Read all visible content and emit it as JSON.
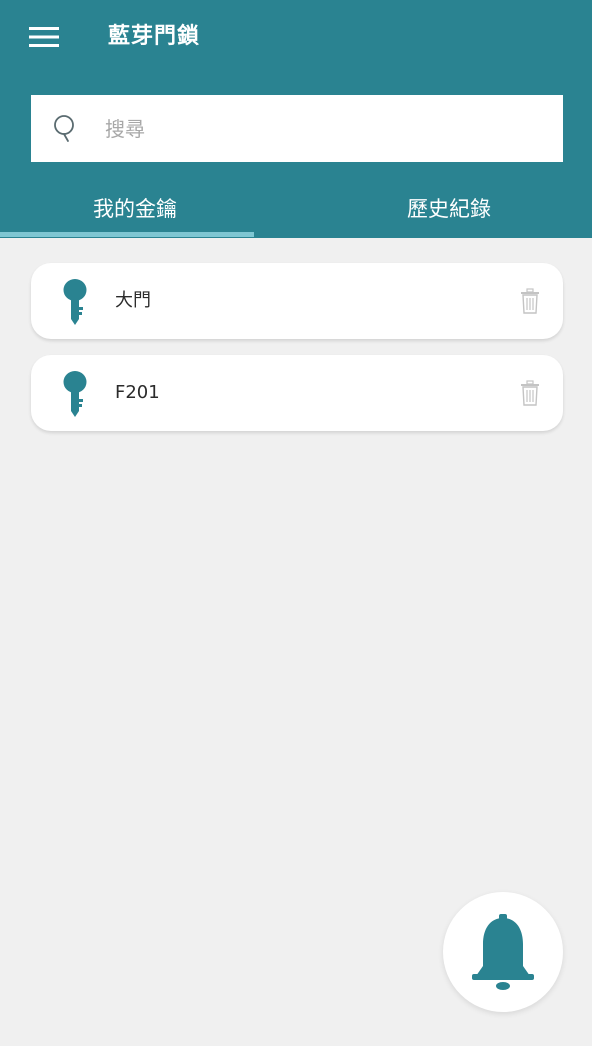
{
  "header": {
    "title": "藍芽門鎖",
    "menu_icon": "hamburger-menu-icon",
    "background_color": "#2a8391"
  },
  "search": {
    "placeholder": "搜尋",
    "value": "",
    "icon": "search-icon"
  },
  "tabs": [
    {
      "label": "我的金鑰",
      "active": true
    },
    {
      "label": "歷史紀錄",
      "active": false
    }
  ],
  "keys": [
    {
      "name": "大門",
      "icon": "key-icon",
      "action_icon": "trash-icon"
    },
    {
      "name": "F201",
      "icon": "key-icon",
      "action_icon": "trash-icon"
    }
  ],
  "fab": {
    "icon": "bell-icon",
    "accent_color": "#2a8391"
  },
  "colors": {
    "accent": "#2a8391",
    "tab_indicator": "#7ec6d2",
    "background": "#f0f0f0"
  }
}
